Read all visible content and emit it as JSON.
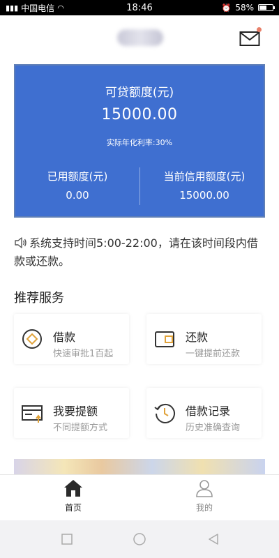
{
  "status_bar": {
    "carrier": "中国电信",
    "time": "18:46",
    "battery": "58%",
    "battery_level": 0.58
  },
  "header": {
    "mail_icon": "mail-icon"
  },
  "credit_card": {
    "available_label": "可贷额度(元)",
    "available_amount": "15000.00",
    "rate_text": "实际年化利率:30%",
    "used_label": "已用额度(元)",
    "used_amount": "0.00",
    "current_label": "当前信用额度(元)",
    "current_amount": "15000.00",
    "background_color": "#3f6fd0"
  },
  "notice": {
    "icon": "speaker-icon",
    "text": "系统支持时间5:00-22:00，请在该时间段内借款或还款。"
  },
  "section": {
    "title": "推荐服务"
  },
  "services": [
    {
      "title": "借款",
      "subtitle": "快速审批1百起",
      "icon": "diamond-coin-icon"
    },
    {
      "title": "还款",
      "subtitle": "一键提前还款",
      "icon": "wallet-icon"
    },
    {
      "title": "我要提额",
      "subtitle": "不同提额方式",
      "icon": "card-up-icon"
    },
    {
      "title": "借款记录",
      "subtitle": "历史准确查询",
      "icon": "history-clock-icon"
    }
  ],
  "tab_bar": {
    "tabs": [
      {
        "label": "首页",
        "icon": "home-icon",
        "active": true
      },
      {
        "label": "我的",
        "icon": "user-icon",
        "active": false
      }
    ]
  }
}
